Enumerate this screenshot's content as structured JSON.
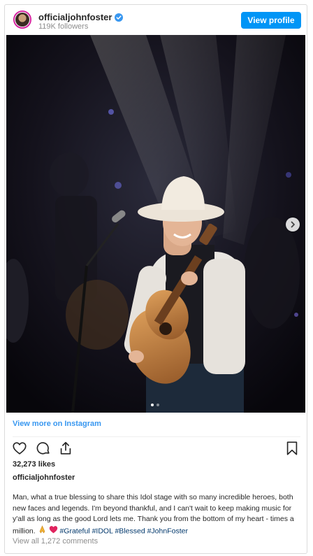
{
  "header": {
    "username": "officialjohnfoster",
    "followers": "119K followers",
    "view_profile_label": "View profile"
  },
  "post": {
    "image_alt": "Performer in white cowboy hat playing acoustic guitar on stage",
    "carousel": {
      "count": 2,
      "active_index": 0
    },
    "view_more_label": "View more on Instagram",
    "likes": "32,273 likes",
    "caption_author": "officialjohnfoster",
    "caption_text": "Man, what a true blessing to share this Idol stage with so many incredible heroes, both new faces and legends. I'm beyond thankful, and I can't wait to keep making music for y'all as long as the good Lord lets me. Thank you from the bottom of my heart - times a million.",
    "hashtags": [
      "#Grateful",
      "#IDOL",
      "#Blessed",
      "#JohnFoster"
    ],
    "view_all_comments": "View all 1,272 comments"
  },
  "colors": {
    "accent": "#0095f6",
    "link": "#3897f0",
    "hashtag": "#00376b",
    "muted": "#8e8e8e",
    "heart": "#ed4956"
  }
}
